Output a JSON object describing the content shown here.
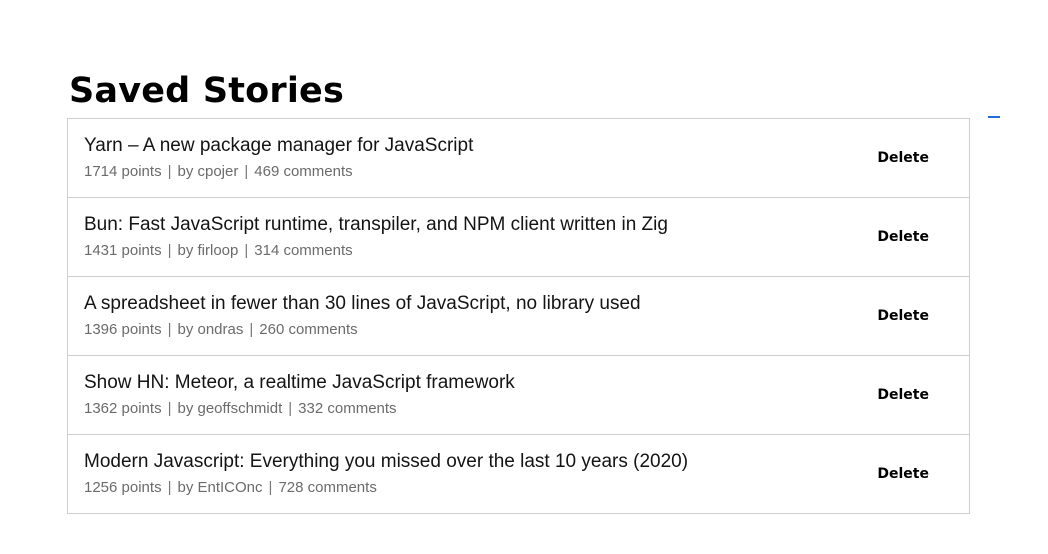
{
  "page": {
    "title": "Saved Stories"
  },
  "stories": [
    {
      "title": "Yarn – A new package manager for JavaScript",
      "points": "1714 points",
      "author": "by cpojer",
      "comments": "469 comments",
      "delete_label": "Delete"
    },
    {
      "title": "Bun: Fast JavaScript runtime, transpiler, and NPM client written in Zig",
      "points": "1431 points",
      "author": "by firloop",
      "comments": "314 comments",
      "delete_label": "Delete"
    },
    {
      "title": "A spreadsheet in fewer than 30 lines of JavaScript, no library used",
      "points": "1396 points",
      "author": "by ondras",
      "comments": "260 comments",
      "delete_label": "Delete"
    },
    {
      "title": "Show HN: Meteor, a realtime JavaScript framework",
      "points": "1362 points",
      "author": "by geoffschmidt",
      "comments": "332 comments",
      "delete_label": "Delete"
    },
    {
      "title": "Modern Javascript: Everything you missed over the last 10 years (2020)",
      "points": "1256 points",
      "author": "by EntICOnc",
      "comments": "728 comments",
      "delete_label": "Delete"
    }
  ],
  "meta": {
    "separator": "|"
  },
  "colors": {
    "border": "#cfcfcf",
    "meta_text": "#6b6b6b",
    "accent": "#1e6fd9"
  }
}
